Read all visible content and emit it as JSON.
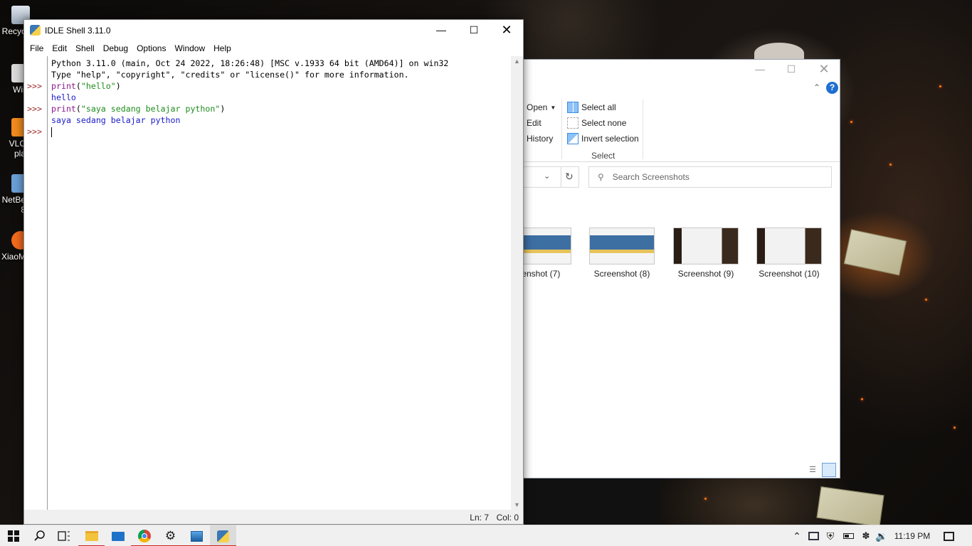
{
  "desktop": {
    "icons": [
      {
        "label": "Recyc",
        "icon": "recycle-bin-icon"
      },
      {
        "label": "Wir",
        "icon": "shortcut-icon"
      },
      {
        "label": "VLC",
        "label2": "pla",
        "icon": "vlc-icon"
      },
      {
        "label": "NetBe",
        "label2": "8",
        "icon": "netbeans-icon"
      },
      {
        "label": "XiaoM",
        "icon": "xiaomi-icon"
      }
    ]
  },
  "explorer": {
    "ribbon": {
      "open_label": "Open",
      "edit_label": "Edit",
      "history_label": "History",
      "select_all_label": "Select all",
      "select_none_label": "Select none",
      "invert_selection_label": "Invert selection",
      "select_group_label": "Select"
    },
    "search_placeholder": "Search Screenshots",
    "files": [
      {
        "name": "eenshot (7)"
      },
      {
        "name": "Screenshot (8)"
      },
      {
        "name": "Screenshot (9)"
      },
      {
        "name": "Screenshot (10)"
      }
    ],
    "help_label": "?"
  },
  "idle": {
    "title": "IDLE Shell 3.11.0",
    "menu": [
      "File",
      "Edit",
      "Shell",
      "Debug",
      "Options",
      "Window",
      "Help"
    ],
    "lines": {
      "banner1": "Python 3.11.0 (main, Oct 24 2022, 18:26:48) [MSC v.1933 64 bit (AMD64)] on win32",
      "banner2": "Type \"help\", \"copyright\", \"credits\" or \"license()\" for more information.",
      "cmd1_kw": "print",
      "cmd1_open": "(",
      "cmd1_str": "\"hello\"",
      "cmd1_close": ")",
      "out1": "hello",
      "cmd2_kw": "print",
      "cmd2_open": "(",
      "cmd2_str": "\"saya sedang belajar python\"",
      "cmd2_close": ")",
      "out2": "saya sedang belajar python"
    },
    "prompts": [
      ">>>",
      ">>>",
      ">>>"
    ],
    "status": {
      "ln": "Ln: 7",
      "col": "Col: 0"
    }
  },
  "taskbar": {
    "clock": "11:19 PM",
    "colors": {
      "active_underline": "#cc2222"
    }
  }
}
